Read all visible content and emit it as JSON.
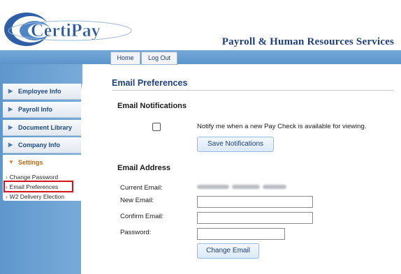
{
  "header": {
    "brand": "CertiPay",
    "tagline": "Payroll & Human Resources Services"
  },
  "topnav": {
    "home": "Home",
    "logout": "Log Out"
  },
  "sidebar": {
    "items": [
      {
        "label": "Employee Info"
      },
      {
        "label": "Payroll Info"
      },
      {
        "label": "Document Library"
      },
      {
        "label": "Company Info"
      },
      {
        "label": "Settings",
        "expanded": true
      }
    ],
    "subitems": [
      {
        "label": "Change Password"
      },
      {
        "label": "Email Preferences",
        "selected": true
      },
      {
        "label": "W2 Delivery Election"
      }
    ]
  },
  "main": {
    "title": "Email Preferences",
    "notifications": {
      "heading": "Email Notifications",
      "checkbox_label": "Notify me when a new Pay Check is available for viewing.",
      "checked": false,
      "save_button": "Save Notifications"
    },
    "address": {
      "heading": "Email Address",
      "current_label": "Current Email:",
      "new_label": "New Email:",
      "confirm_label": "Confirm Email:",
      "password_label": "Password:",
      "new_value": "",
      "confirm_value": "",
      "password_value": "",
      "change_button": "Change Email"
    }
  },
  "colors": {
    "brand_blue": "#1f3f7f",
    "sidebar_blue": "#6aa0d3",
    "highlight_red": "#d0161c",
    "settings_orange": "#c26a12"
  }
}
